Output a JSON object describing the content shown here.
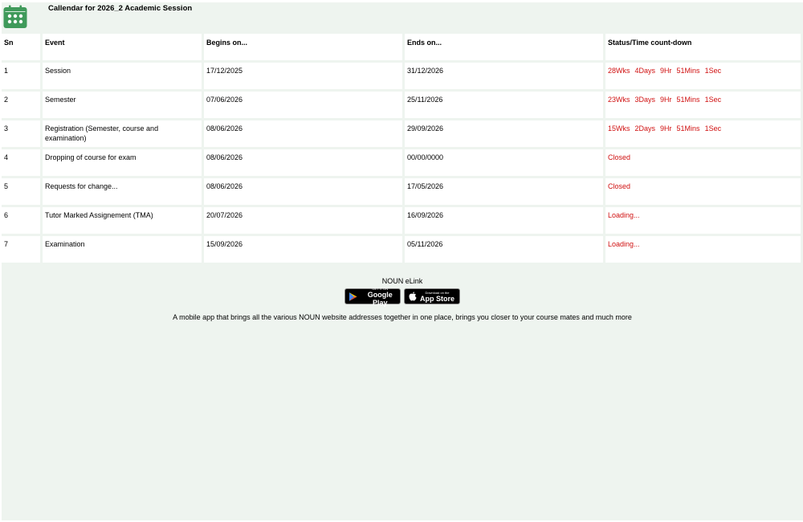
{
  "header": {
    "title": "Callendar for 2026_2 Academic Session",
    "icon": "calendar-icon"
  },
  "table": {
    "columns": [
      "Sn",
      "Event",
      "Begins on...",
      "Ends on...",
      "Status/Time count-down"
    ],
    "rows": [
      {
        "sn": "1",
        "event": "Session",
        "begins": "17/12/2025",
        "ends": "31/12/2026",
        "status": [
          "28Wks",
          "4Days",
          "9Hr",
          "51Mins",
          "1Sec"
        ]
      },
      {
        "sn": "2",
        "event": "Semester",
        "begins": "07/06/2026",
        "ends": "25/11/2026",
        "status": [
          "23Wks",
          "3Days",
          "9Hr",
          "51Mins",
          "1Sec"
        ]
      },
      {
        "sn": "3",
        "event": "Registration (Semester, course and examination)",
        "begins": "08/06/2026",
        "ends": "29/09/2026",
        "status": [
          "15Wks",
          "2Days",
          "9Hr",
          "51Mins",
          "1Sec"
        ]
      },
      {
        "sn": "4",
        "event": "Dropping of course for exam",
        "begins": "08/06/2026",
        "ends": "00/00/0000",
        "status": [
          "Closed"
        ]
      },
      {
        "sn": "5",
        "event": "Requests for change...",
        "begins": "08/06/2026",
        "ends": "17/05/2026",
        "status": [
          "Closed"
        ]
      },
      {
        "sn": "6",
        "event": "Tutor Marked Assignement (TMA)",
        "begins": "20/07/2026",
        "ends": "16/09/2026",
        "status": [
          "Loading..."
        ]
      },
      {
        "sn": "7",
        "event": "Examination",
        "begins": "15/09/2026",
        "ends": "05/11/2026",
        "status": [
          "Loading..."
        ]
      }
    ]
  },
  "footer": {
    "app_name": "NOUN eLink",
    "google_play": {
      "small": "GET IT ON",
      "big": "Google Play",
      "icon": "play-store-icon"
    },
    "app_store": {
      "small": "Download on the",
      "big": "App Store",
      "icon": "apple-icon"
    },
    "description": "A mobile app that brings all the various NOUN website addresses together in one place, brings you closer to your course mates and much more"
  },
  "colors": {
    "background": "#eef4ef",
    "icon_green": "#3f9a5a",
    "status_red": "#d01010"
  }
}
